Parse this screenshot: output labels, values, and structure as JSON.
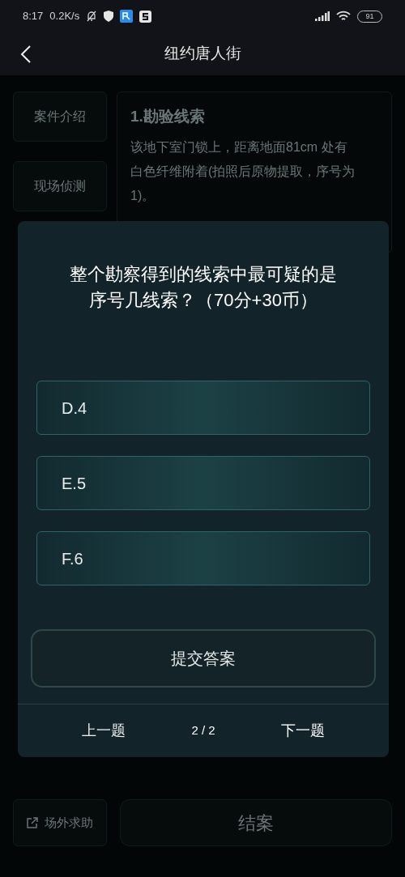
{
  "status_bar": {
    "time": "8:17",
    "speed": "0.2K/s",
    "battery": "91"
  },
  "header": {
    "title": "纽约唐人街"
  },
  "sidebar": {
    "items": [
      {
        "label": "案件介绍"
      },
      {
        "label": "现场侦测"
      }
    ]
  },
  "article": {
    "heading": "1.勘验线索",
    "paragraph": "该地下室门锁上，距离地面81cm 处有白色纤维附着(拍照后原物提取，序号为1)。"
  },
  "footer_actions": [
    {
      "label": "场外求助",
      "kind": "help"
    },
    {
      "label": "结案",
      "kind": "close_case"
    }
  ],
  "quiz": {
    "question_lines": [
      "整个勘察得到的线索中最可疑的是",
      "序号几线索？（70分+30币）"
    ],
    "options": [
      {
        "label": "D.4",
        "selected": false
      },
      {
        "label": "E.5",
        "selected": false
      },
      {
        "label": "F.6",
        "selected": false
      }
    ],
    "submit": "提交答案",
    "prev": "上一题",
    "page": "2 / 2",
    "next": "下一题"
  }
}
